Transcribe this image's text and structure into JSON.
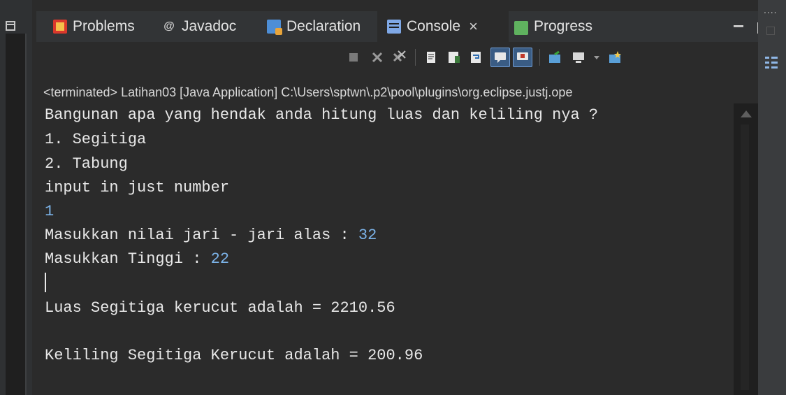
{
  "tabs": [
    {
      "label": "Problems",
      "icon": "problems-icon"
    },
    {
      "label": "Javadoc",
      "icon": "javadoc-icon"
    },
    {
      "label": "Declaration",
      "icon": "declaration-icon"
    },
    {
      "label": "Console",
      "icon": "console-icon",
      "active": true
    },
    {
      "label": "Progress",
      "icon": "progress-icon"
    }
  ],
  "close_glyph": "×",
  "javadoc_glyph": "@",
  "right_dots": "....",
  "toolbar": {
    "buttons": [
      "terminate-icon",
      "remove-launch-icon",
      "remove-all-terminated-icon",
      "clear-console-icon",
      "scroll-lock-icon",
      "word-wrap-icon",
      "show-on-stdout-icon",
      "show-on-stderr-icon",
      "pin-console-icon",
      "display-selected-console-icon",
      "dropdown-icon",
      "open-console-icon"
    ]
  },
  "status": "<terminated> Latihan03 [Java Application] C:\\Users\\sptwn\\.p2\\pool\\plugins\\org.eclipse.justj.ope",
  "console": {
    "lines": [
      {
        "text": "Bangunan apa yang hendak anda hitung luas dan keliling nya ?"
      },
      {
        "text": "1. Segitiga"
      },
      {
        "text": "2. Tabung"
      },
      {
        "text": "input in just number"
      },
      {
        "text": "",
        "input": "1"
      },
      {
        "text": "Masukkan nilai jari - jari alas : ",
        "input": "32"
      },
      {
        "text": "Masukkan Tinggi : ",
        "input": "22"
      },
      {
        "text": ""
      },
      {
        "text": "Luas Segitiga kerucut adalah = 2210.56"
      },
      {
        "text": ""
      },
      {
        "text": "Keliling Segitiga Kerucut adalah = 200.96"
      }
    ]
  },
  "colors": {
    "background": "#2b2b2b",
    "tabbar": "#323436",
    "stdin": "#7cb3e8",
    "text": "#e8e8e8"
  }
}
